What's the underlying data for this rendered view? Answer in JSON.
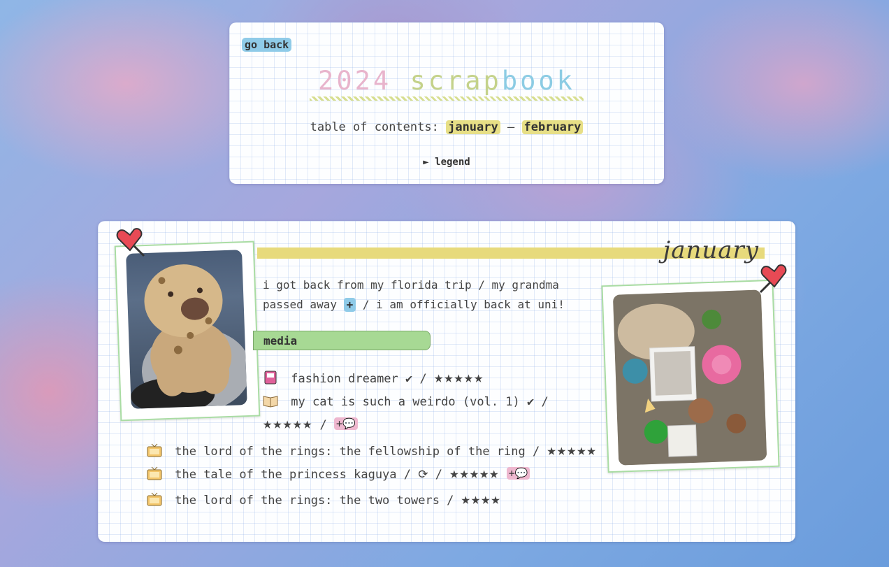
{
  "header": {
    "go_back": "go back",
    "title_year": "2024",
    "title_scrap": "scrap",
    "title_book": "book",
    "toc_label": "table of contents:",
    "toc_sep": "–",
    "toc_items": [
      "january",
      "february"
    ],
    "legend": "► legend"
  },
  "month": {
    "title": "january",
    "intro_line1": "i got back from my florida trip / my grandma",
    "intro_line2_a": "passed away",
    "intro_plus": "+",
    "intro_line2_b": "/ i am officially back at uni!",
    "media_label": "media"
  },
  "media": [
    {
      "icon": "game-console-icon",
      "title": "fashion dreamer",
      "suffix": "✔ /",
      "stars": "★★★★★"
    },
    {
      "icon": "open-book-icon",
      "title": "my cat is such a weirdo (vol. 1)",
      "suffix": "✔ /",
      "stars": "★★★★★",
      "chip": "+💬"
    },
    {
      "icon": "tv-icon",
      "title": "the lord of the rings: the fellowship of the ring /",
      "stars": "★★★★★"
    },
    {
      "icon": "tv-icon",
      "title": "the tale of the princess kaguya / ⟳ /",
      "stars": "★★★★★",
      "chip": "+💬"
    },
    {
      "icon": "tv-icon",
      "title": "the lord of the rings: the two towers /",
      "stars": "★★★★"
    }
  ],
  "colors": {
    "yellow_chip": "#e7df86",
    "blue_chip": "#8fcbe8",
    "green_label": "#a7d994",
    "pink_chip": "#eeb7cf"
  }
}
